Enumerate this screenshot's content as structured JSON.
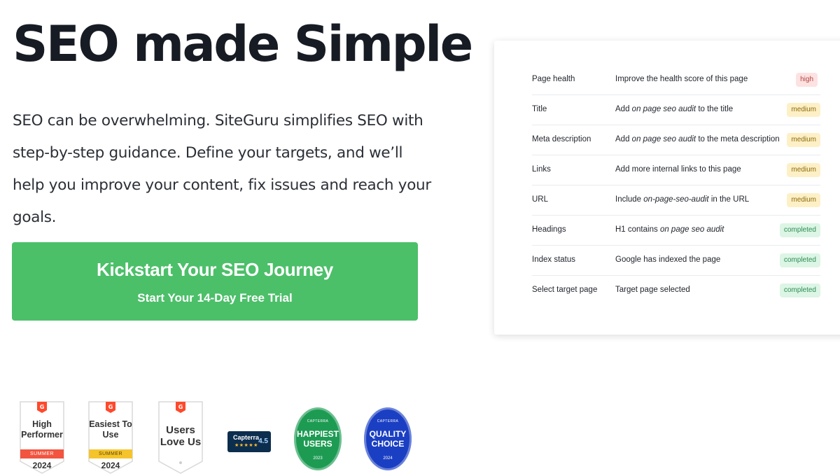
{
  "hero": {
    "title": "SEO made Simple",
    "description": "SEO can be overwhelming. SiteGuru simplifies SEO with step-by-step guidance. Define your targets, and we’ll help you improve your content, fix issues and reach your goals."
  },
  "cta": {
    "label": "Kickstart Your SEO Journey",
    "sublabel": "Start Your 14-Day Free Trial",
    "color": "#4cbf69"
  },
  "audit": {
    "rows": [
      {
        "check": "Page health",
        "action_pre": "Improve the health score of this page",
        "keyword": "",
        "action_post": "",
        "priority": "high"
      },
      {
        "check": "Title",
        "action_pre": "Add ",
        "keyword": "on page seo audit",
        "action_post": " to the title",
        "priority": "medium"
      },
      {
        "check": "Meta description",
        "action_pre": "Add ",
        "keyword": "on page seo audit",
        "action_post": " to the meta description",
        "priority": "medium"
      },
      {
        "check": "Links",
        "action_pre": "Add more internal links to this page",
        "keyword": "",
        "action_post": "",
        "priority": "medium"
      },
      {
        "check": "URL",
        "action_pre": "Include ",
        "keyword": "on-page-seo-audit",
        "action_post": " in the URL",
        "priority": "medium"
      },
      {
        "check": "Headings",
        "action_pre": "H1 contains ",
        "keyword": "on page seo audit",
        "action_post": "",
        "priority": "completed"
      },
      {
        "check": "Index status",
        "action_pre": "Google has indexed the page",
        "keyword": "",
        "action_post": "",
        "priority": "completed"
      },
      {
        "check": "Select target page",
        "action_pre": "Target page selected",
        "keyword": "",
        "action_post": "",
        "priority": "completed"
      }
    ]
  },
  "awards": {
    "g2_high_performer": {
      "title": "High Performer",
      "season": "SUMMER",
      "year": "2024",
      "band_color": "#f2543f"
    },
    "g2_easiest_to_use": {
      "title": "Easiest To Use",
      "season": "SUMMER",
      "year": "2024",
      "band_color": "#f5c42c"
    },
    "g2_users_love_us": {
      "title": "Users Love Us"
    },
    "capterra": {
      "name": "Capterra",
      "stars": "★★★★★",
      "score": "4.5"
    },
    "happiest_users": {
      "brand": "CAPTERRA",
      "title": "HAPPIEST USERS",
      "year": "2023"
    },
    "quality_choice": {
      "brand": "CAPTERRA",
      "title": "QUALITY CHOICE",
      "year": "2024"
    }
  }
}
